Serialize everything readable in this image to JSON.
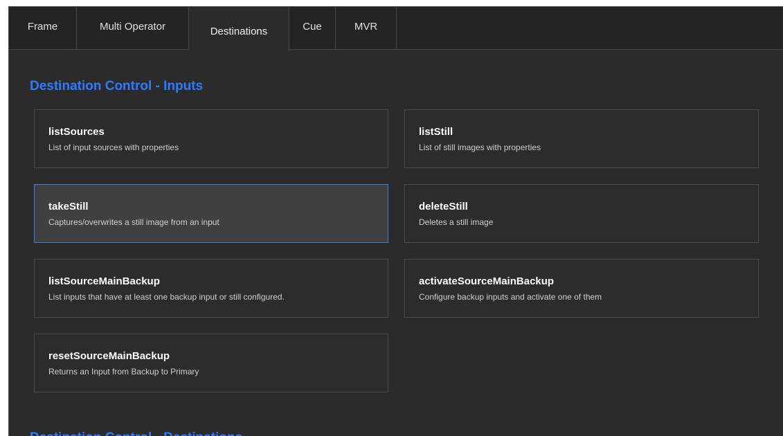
{
  "tabs": [
    {
      "label": "Frame"
    },
    {
      "label": "Multi Operator"
    },
    {
      "label": "Destinations"
    },
    {
      "label": "Cue"
    },
    {
      "label": "MVR"
    }
  ],
  "sections": {
    "inputs_title": "Destination Control - Inputs",
    "destinations_title": "Destination Control - Destinations"
  },
  "cards": [
    {
      "title": "listSources",
      "desc": "List of input sources with properties"
    },
    {
      "title": "listStill",
      "desc": "List of still images with properties"
    },
    {
      "title": "takeStill",
      "desc": "Captures/overwrites a still image from an input"
    },
    {
      "title": "deleteStill",
      "desc": "Deletes a still image"
    },
    {
      "title": "listSourceMainBackup",
      "desc": "List inputs that have at least one backup input or still configured."
    },
    {
      "title": "activateSourceMainBackup",
      "desc": "Configure backup inputs and activate one of them"
    },
    {
      "title": "resetSourceMainBackup",
      "desc": "Returns an Input from Backup to Primary"
    }
  ],
  "colors": {
    "accent": "#2e7bff",
    "selected_border": "#3d7fe0"
  }
}
